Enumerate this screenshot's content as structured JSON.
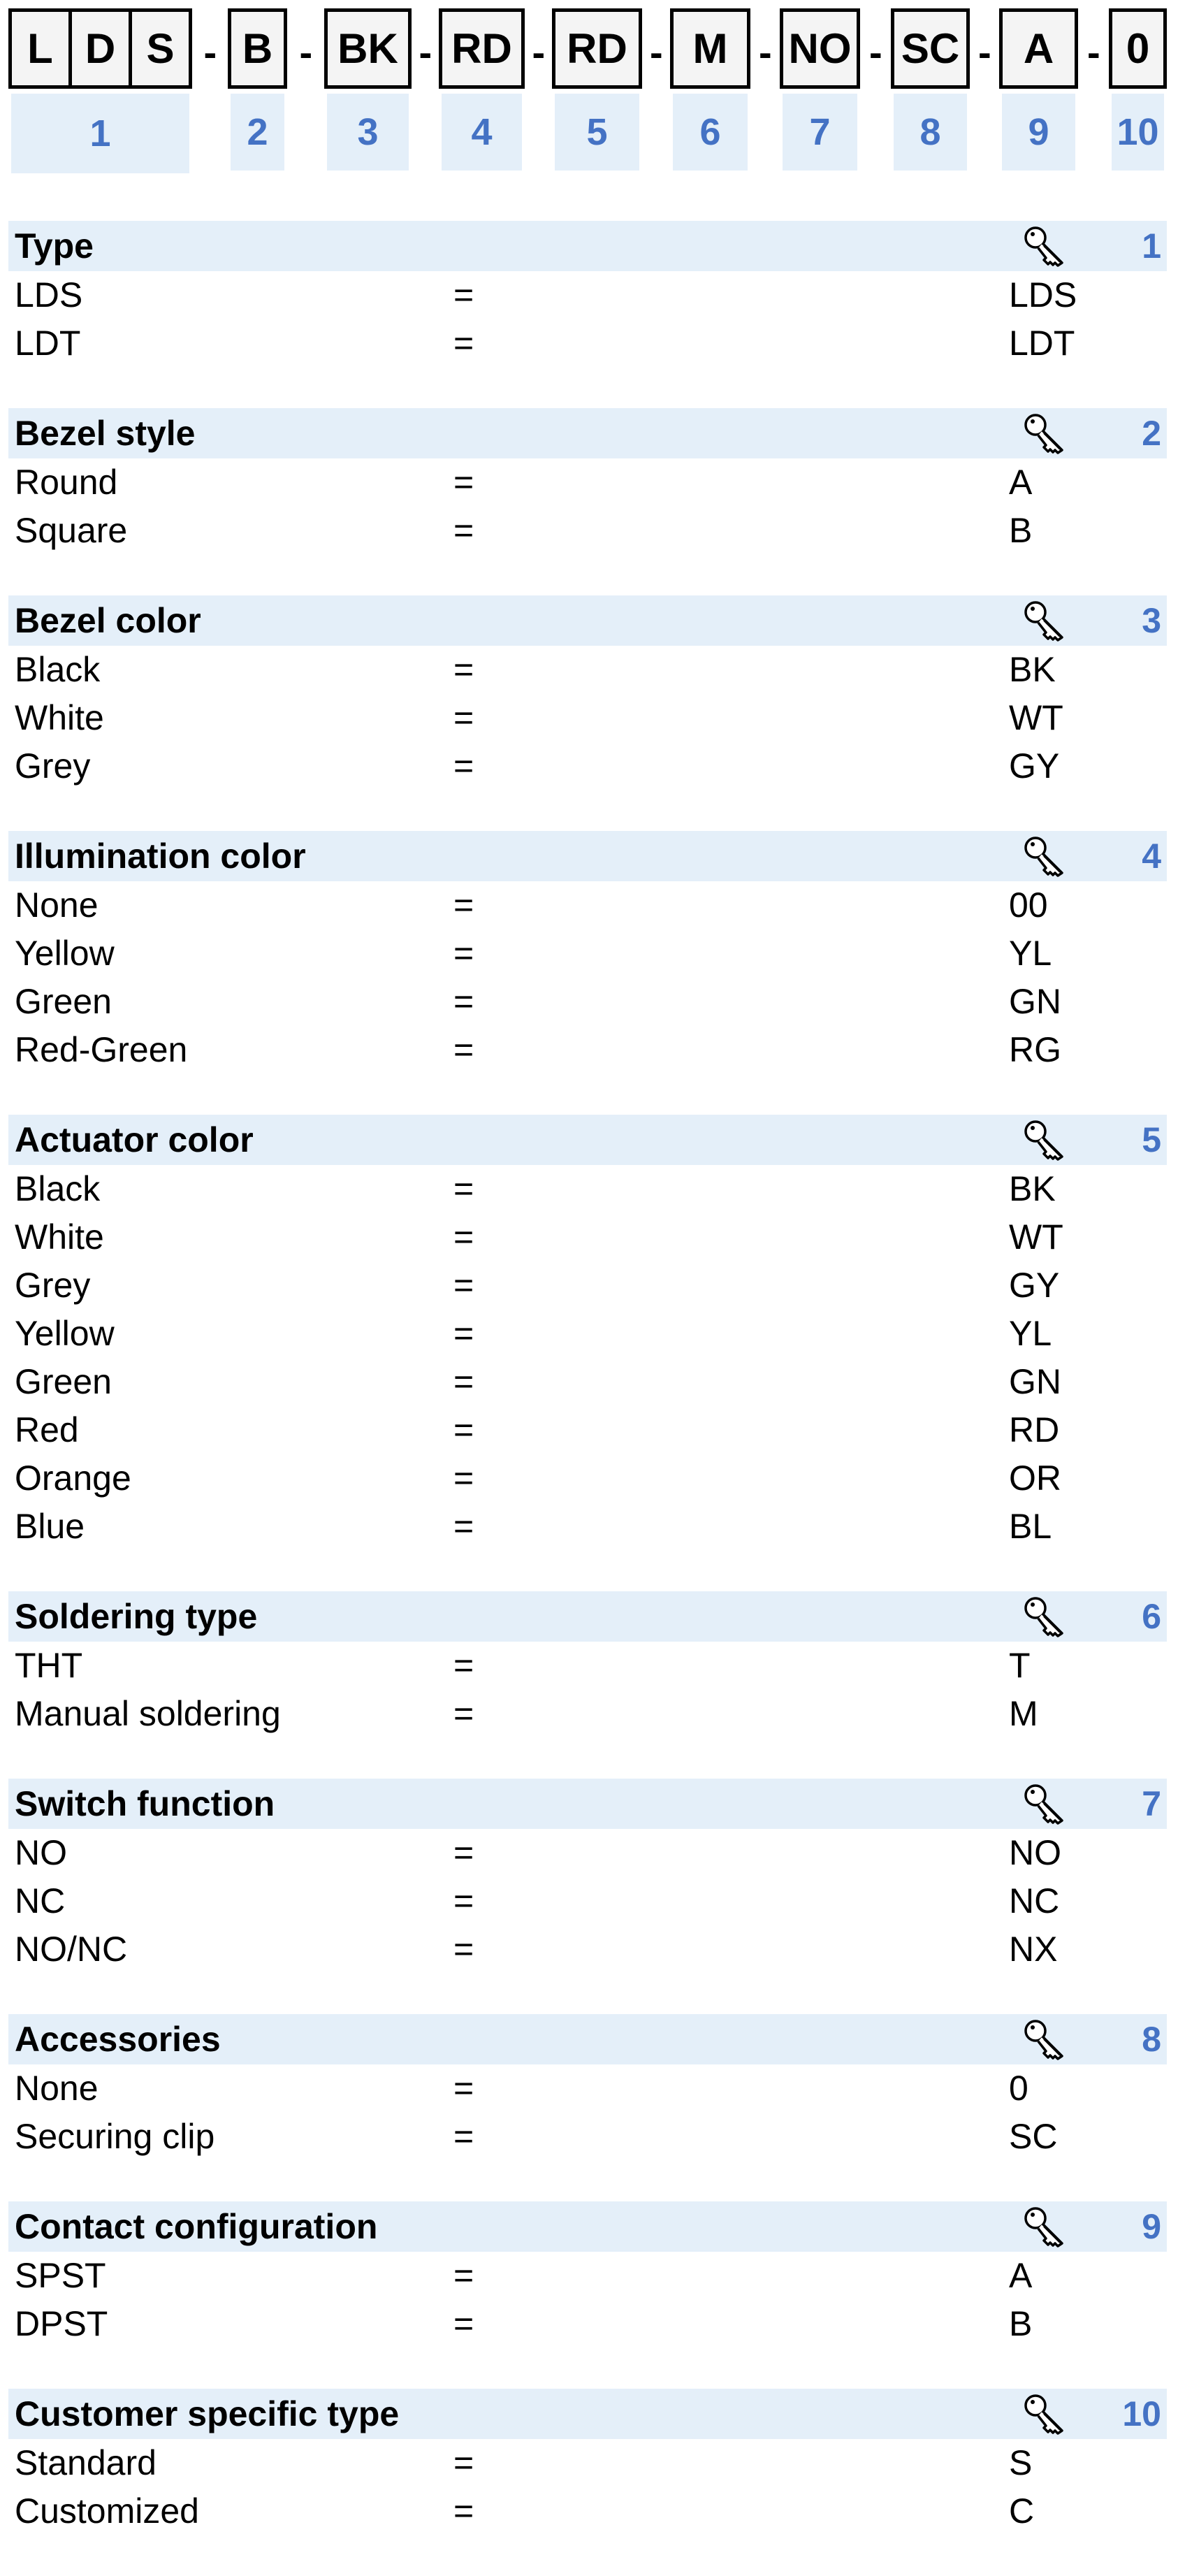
{
  "code": {
    "boxes": [
      {
        "chars": [
          "L",
          "D",
          "S"
        ],
        "number": "1"
      },
      {
        "chars": [
          "B"
        ],
        "number": "2"
      },
      {
        "chars": [
          "BK"
        ],
        "number": "3"
      },
      {
        "chars": [
          "RD"
        ],
        "number": "4"
      },
      {
        "chars": [
          "RD"
        ],
        "number": "5"
      },
      {
        "chars": [
          "M"
        ],
        "number": "6"
      },
      {
        "chars": [
          "NO"
        ],
        "number": "7"
      },
      {
        "chars": [
          "SC"
        ],
        "number": "8"
      },
      {
        "chars": [
          "A"
        ],
        "number": "9"
      },
      {
        "chars": [
          "0"
        ],
        "number": "10"
      }
    ],
    "separator": "-"
  },
  "colors": {
    "accent": "#4472c4",
    "band": "#e4eff9"
  },
  "equals": "=",
  "sections": [
    {
      "title": "Type",
      "number": "1",
      "icon": "key-icon",
      "rows": [
        [
          "LDS",
          "LDS"
        ],
        [
          "LDT",
          "LDT"
        ]
      ]
    },
    {
      "title": "Bezel style",
      "number": "2",
      "icon": "key-icon",
      "rows": [
        [
          "Round",
          "A"
        ],
        [
          "Square",
          "B"
        ]
      ]
    },
    {
      "title": "Bezel color",
      "number": "3",
      "icon": "key-icon",
      "rows": [
        [
          "Black",
          "BK"
        ],
        [
          "White",
          "WT"
        ],
        [
          "Grey",
          "GY"
        ]
      ]
    },
    {
      "title": "Illumination color",
      "number": "4",
      "icon": "key-icon",
      "rows": [
        [
          "None",
          "00"
        ],
        [
          "Yellow",
          "YL"
        ],
        [
          "Green",
          "GN"
        ],
        [
          "Red-Green",
          "RG"
        ]
      ]
    },
    {
      "title": "Actuator color",
      "number": "5",
      "icon": "key-icon",
      "rows": [
        [
          "Black",
          "BK"
        ],
        [
          "White",
          "WT"
        ],
        [
          "Grey",
          "GY"
        ],
        [
          "Yellow",
          "YL"
        ],
        [
          "Green",
          "GN"
        ],
        [
          "Red",
          "RD"
        ],
        [
          "Orange",
          "OR"
        ],
        [
          "Blue",
          "BL"
        ]
      ]
    },
    {
      "title": "Soldering type",
      "number": "6",
      "icon": "key-icon",
      "rows": [
        [
          "THT",
          "T"
        ],
        [
          "Manual soldering",
          "M"
        ]
      ]
    },
    {
      "title": "Switch function",
      "number": "7",
      "icon": "key-icon",
      "rows": [
        [
          "NO",
          "NO"
        ],
        [
          "NC",
          "NC"
        ],
        [
          "NO/NC",
          "NX"
        ]
      ]
    },
    {
      "title": "Accessories",
      "number": "8",
      "icon": "key-icon",
      "rows": [
        [
          "None",
          "0"
        ],
        [
          "Securing clip",
          "SC"
        ]
      ]
    },
    {
      "title": "Contact configuration",
      "number": "9",
      "icon": "key-icon",
      "rows": [
        [
          "SPST",
          "A"
        ],
        [
          "DPST",
          "B"
        ]
      ]
    },
    {
      "title": "Customer specific type",
      "number": "10",
      "icon": "key-icon",
      "rows": [
        [
          "Standard",
          "S"
        ],
        [
          "Customized",
          "C"
        ]
      ]
    }
  ]
}
